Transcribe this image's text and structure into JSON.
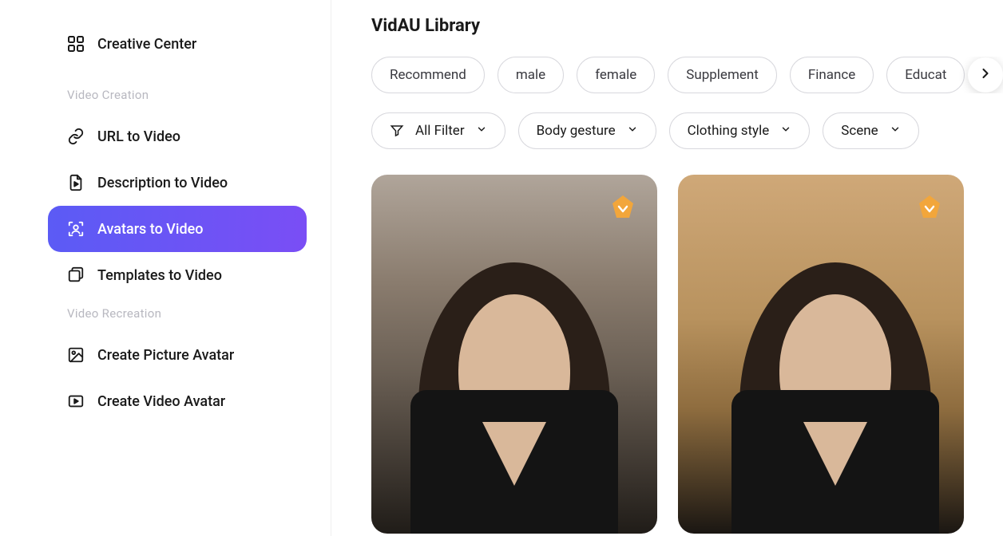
{
  "sidebar": {
    "top": {
      "label": "Creative Center"
    },
    "sections": [
      {
        "title": "Video Creation",
        "items": [
          {
            "label": "URL to Video",
            "icon": "link-icon",
            "active": false
          },
          {
            "label": "Description to Video",
            "icon": "doc-play-icon",
            "active": false
          },
          {
            "label": "Avatars to Video",
            "icon": "avatar-scan-icon",
            "active": true
          },
          {
            "label": "Templates to Video",
            "icon": "templates-icon",
            "active": false
          }
        ]
      },
      {
        "title": "Video Recreation",
        "items": [
          {
            "label": "Create Picture Avatar",
            "icon": "picture-icon",
            "active": false
          },
          {
            "label": "Create Video Avatar",
            "icon": "video-rect-icon",
            "active": false
          }
        ]
      }
    ]
  },
  "main": {
    "title": "VidAU Library",
    "categories": [
      "Recommend",
      "male",
      "female",
      "Supplement",
      "Finance",
      "Educat"
    ],
    "filters": {
      "all": "All Filter",
      "body": "Body gesture",
      "clothing": "Clothing style",
      "scene": "Scene"
    },
    "cards": [
      {
        "badge_color": "#f2a63b"
      },
      {
        "badge_color": "#f2a63b"
      }
    ]
  },
  "colors": {
    "accent_gradient_from": "#5b5bf5",
    "accent_gradient_to": "#7a4ef5"
  }
}
